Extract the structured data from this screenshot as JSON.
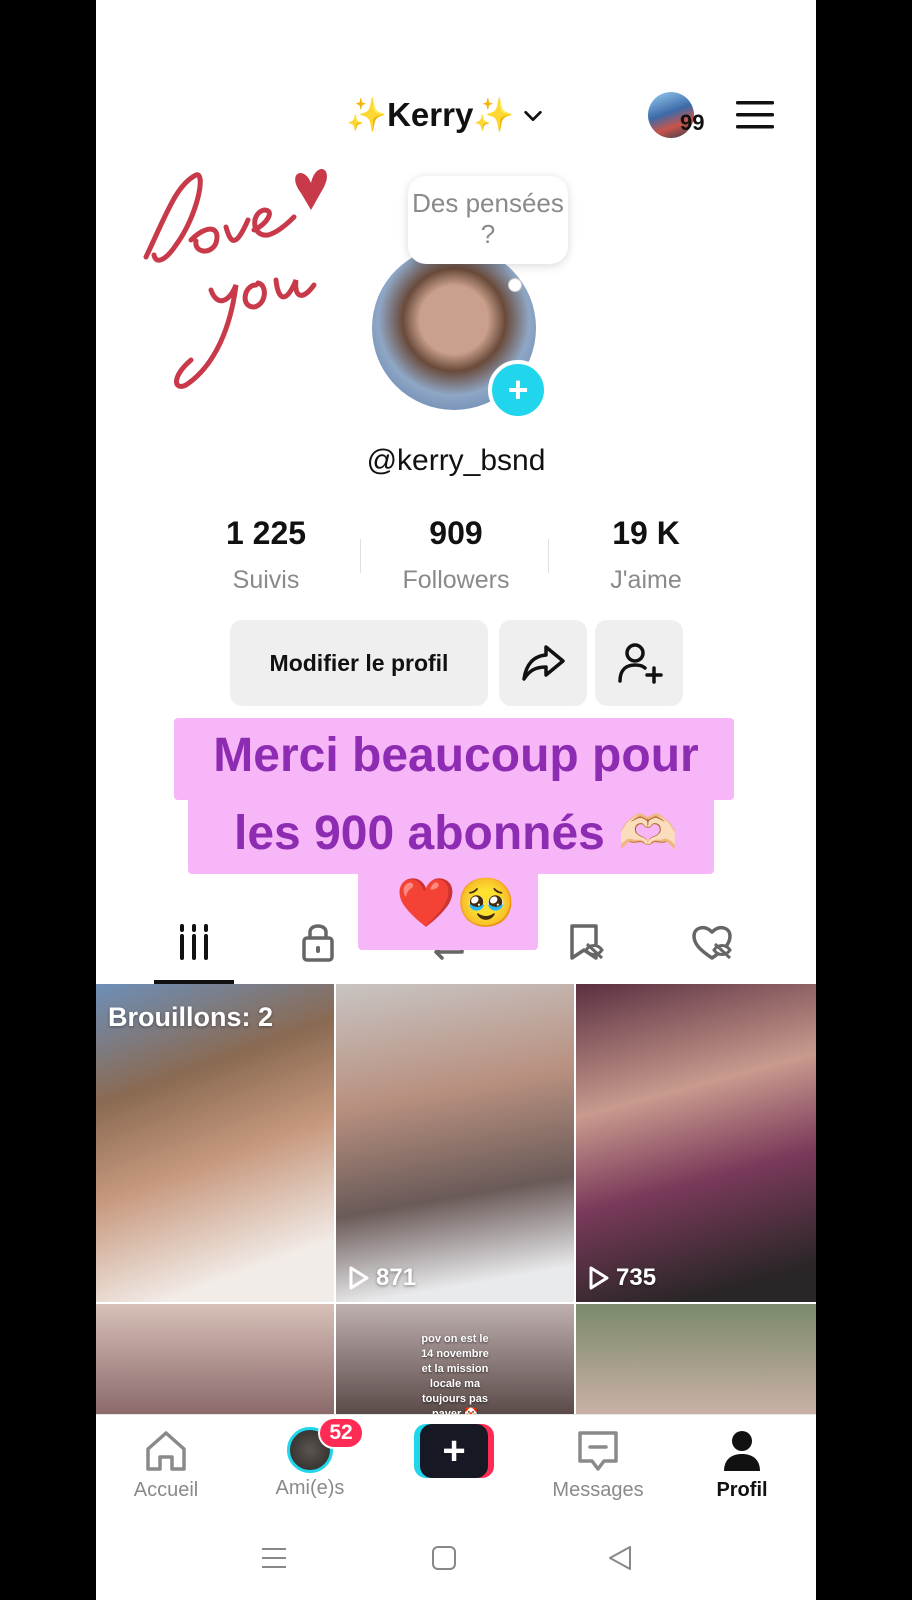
{
  "header": {
    "title": "✨Kerry✨",
    "story_count": "99"
  },
  "profile": {
    "thought_bubble": "Des pensées ?",
    "username": "@kerry_bsnd",
    "stats": [
      {
        "value": "1 225",
        "label": "Suivis"
      },
      {
        "value": "909",
        "label": "Followers"
      },
      {
        "value": "19 K",
        "label": "J'aime"
      }
    ],
    "edit_button": "Modifier le profil"
  },
  "overlay": {
    "line1": "Merci beaucoup pour",
    "line2": "les 900 abonnés 🫶🏻",
    "line3": "❤️🥹"
  },
  "grid": {
    "drafts_label": "Brouillons: 2",
    "videos": [
      {
        "views": "871"
      },
      {
        "views": "735"
      }
    ],
    "caption_text": "pov on est le 14 novembre et la mission locale ma toujours pas payer 🤡"
  },
  "nav": {
    "home": "Accueil",
    "friends": "Ami(e)s",
    "friends_badge": "52",
    "messages": "Messages",
    "profile": "Profil"
  },
  "colors": {
    "accent_cyan": "#20d5ec",
    "accent_pink": "#fe2c55",
    "caption_bg": "#f7b6f7",
    "caption_text": "#8d2cb3"
  }
}
